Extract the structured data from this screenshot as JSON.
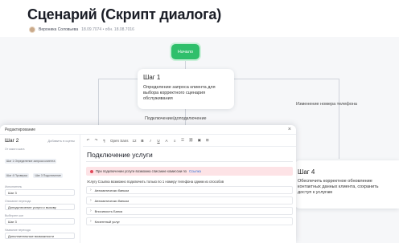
{
  "page": {
    "title": "Сценарий (Скрипт диалога)",
    "author": "Вероника Соловьева",
    "dates": "18.09.7074 • обн. 18.08.7016"
  },
  "flow": {
    "start_label": "Начало",
    "step1": {
      "title": "Шаг 1",
      "text": "Определение запроса клиента для выбора корректного сценария обслуживания"
    },
    "branch_left": "Подключение/доподключение",
    "branch_right": "Изменение номера телефона",
    "step4": {
      "title": "Шаг 4",
      "text": "Обеспечить корректное обновление контактных данных клиента, сохранить доступ к услугам"
    }
  },
  "editor": {
    "header": "Редактирование",
    "step_title": "Шаг 2",
    "step_action": "Добавить в сцены",
    "from_step_label": "От какого шага",
    "chips": [
      "Шаг 1 Определение запроса клиента",
      "Шаг 4 Проверка",
      "Шаг 3 Подключение"
    ],
    "fields": [
      {
        "label": "Исполнитель",
        "value": "Шаг 3"
      },
      {
        "label": "Описание перехода",
        "value": "Доподключение услуги к вызову"
      },
      {
        "label": "Выберите шаг",
        "value": "Шаг 3"
      },
      {
        "label": "Название перехода",
        "value": "Дополнительные возможности"
      }
    ],
    "toolbar": {
      "font": "Open Sans",
      "size": "12",
      "undo": "↶",
      "redo": "↷"
    },
    "doc_title": "Подключение услуги",
    "alert_text": "При подключении услуги возможна списание комиссии по",
    "alert_link": "Ссылка",
    "para_text": "Услугу Ссылка возможно подключить только по 1 номеру телефона одним из способов",
    "options": [
      "Автоматически банком",
      "Автоматически банком",
      "Вносимость Банка",
      "Клиентный услуг"
    ]
  },
  "icons": {
    "close": "close-icon",
    "chevron": "chevron-right-icon"
  }
}
